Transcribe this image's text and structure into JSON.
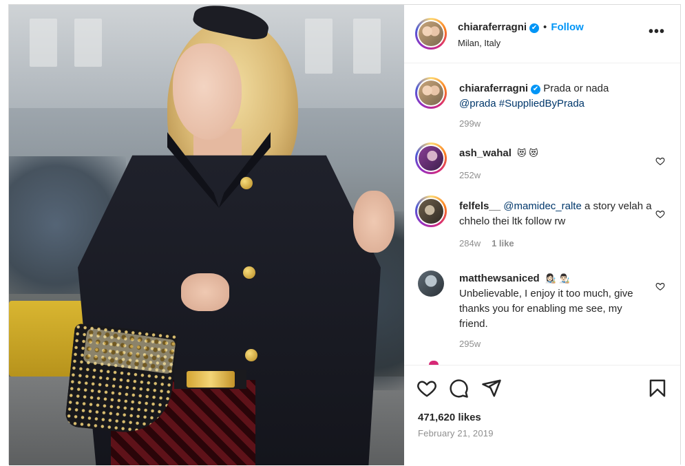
{
  "post_author": {
    "username": "chiaraferragni",
    "verified_badge": "✔",
    "separator": "•",
    "follow_label": "Follow",
    "location": "Milan, Italy",
    "more_options": "•••"
  },
  "caption": {
    "username": "chiaraferragni",
    "text": "Prada or nada",
    "mention": "@prada",
    "hashtag": "#SuppliedByPrada",
    "time": "299w"
  },
  "comments": [
    {
      "username": "ash_wahal",
      "text": "😻 😻",
      "time": "252w",
      "likes": ""
    },
    {
      "username": "felfels__",
      "mention": "@mamidec_ralte",
      "text": "a story velah a chhelo thei ltk follow rw",
      "time": "284w",
      "likes": "1 like"
    },
    {
      "username": "matthewsaniced",
      "emojis": "👩🏻‍🎨 👨🏻‍🎨",
      "text": "Unbelievable, I enjoy it too much, give thanks you for enabling me see, my friend.",
      "time": "295w",
      "likes": ""
    }
  ],
  "engagement": {
    "likes": "471,620 likes",
    "date": "February 21, 2019"
  },
  "icons": [
    "heart-icon",
    "comment-icon",
    "share-icon",
    "bookmark-icon",
    "verified-icon",
    "more-options-icon"
  ],
  "colors": {
    "accent": "#0095f6",
    "link": "#00376b",
    "muted": "#8e8e8e",
    "text": "#262626"
  }
}
